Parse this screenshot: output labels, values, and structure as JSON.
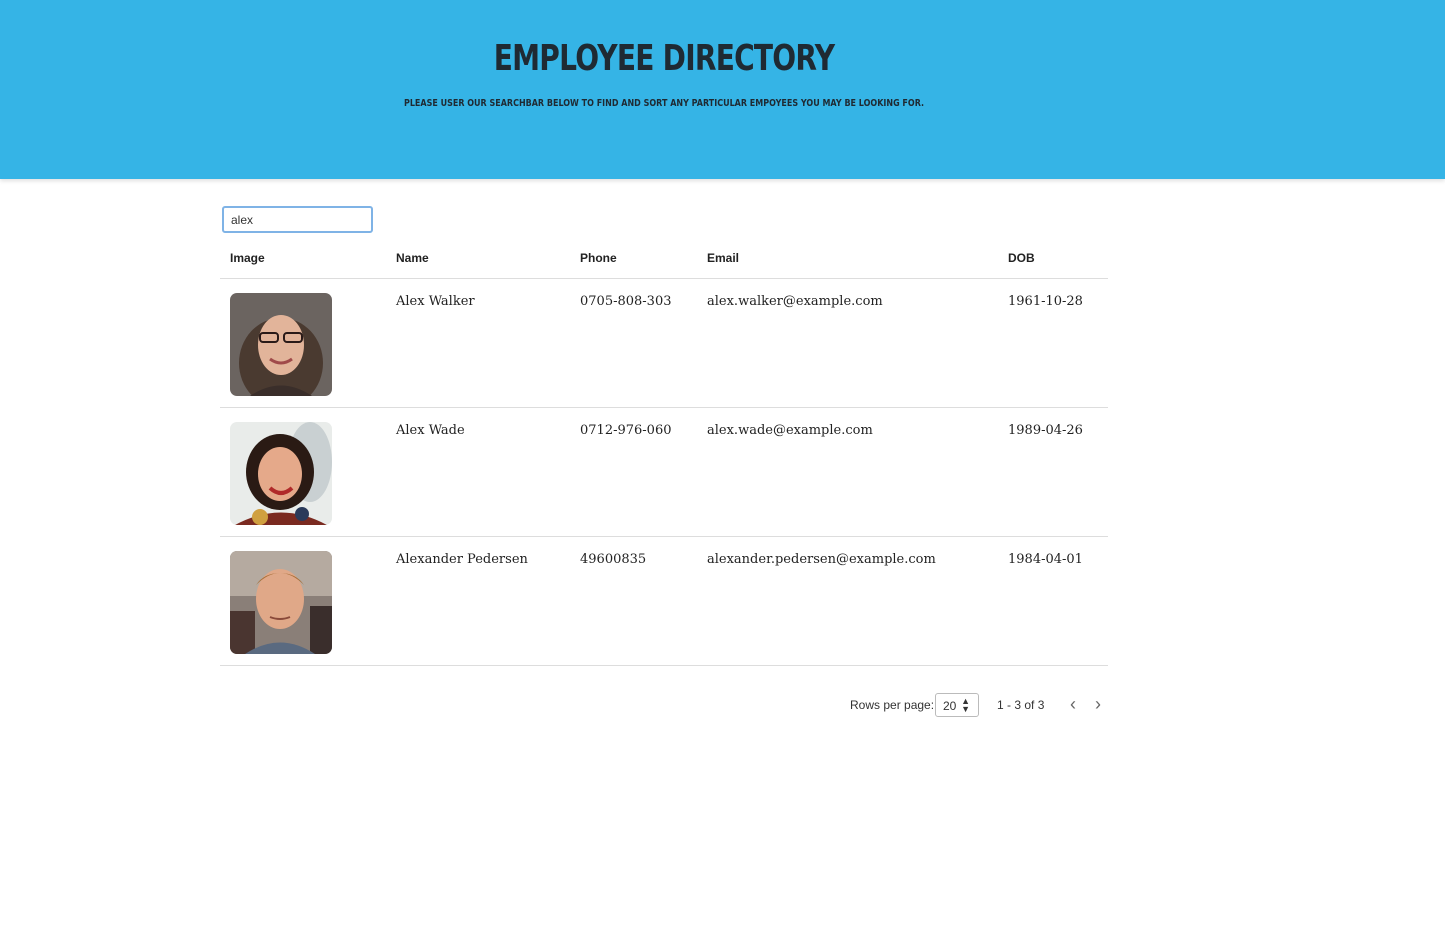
{
  "header": {
    "title": "Employee Directory",
    "subtitle": "Please user our searchbar below to find and sort any particular empoyees you may be looking for."
  },
  "search": {
    "value": "alex"
  },
  "table": {
    "columns": [
      "Image",
      "Name",
      "Phone",
      "Email",
      "DOB"
    ],
    "rows": [
      {
        "image": "portrait-photo",
        "name": "Alex Walker",
        "phone": "0705-808-303",
        "email": "alex.walker@example.com",
        "dob": "1961-10-28"
      },
      {
        "image": "portrait-photo",
        "name": "Alex Wade",
        "phone": "0712-976-060",
        "email": "alex.wade@example.com",
        "dob": "1989-04-26"
      },
      {
        "image": "portrait-photo",
        "name": "Alexander Pedersen",
        "phone": "49600835",
        "email": "alexander.pedersen@example.com",
        "dob": "1984-04-01"
      }
    ]
  },
  "pagination": {
    "rows_per_page_label": "Rows per page:",
    "rows_per_page_value": "20",
    "range_text": "1 - 3 of 3",
    "prev_icon": "chevron-left-icon",
    "next_icon": "chevron-right-icon"
  },
  "colors": {
    "header_bg": "#35b4e6",
    "title": "#1f2a33"
  }
}
